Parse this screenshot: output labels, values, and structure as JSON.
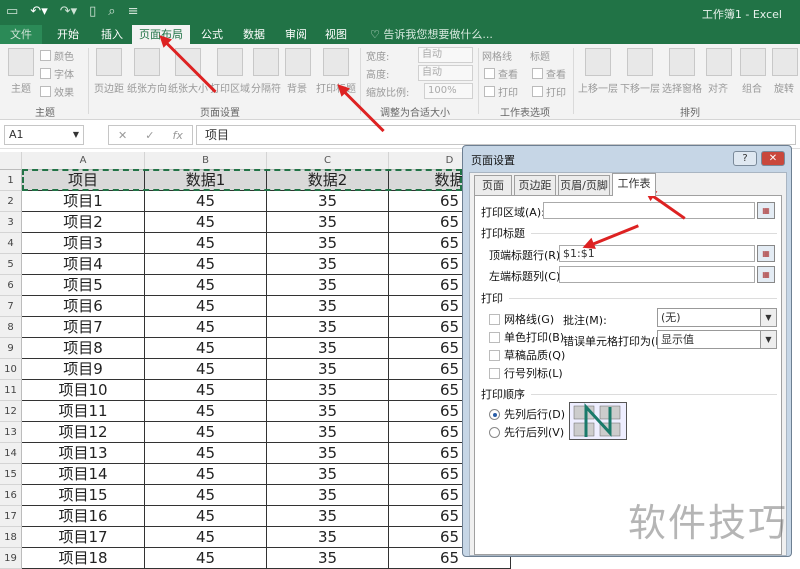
{
  "window": {
    "title": "工作簿1 - Excel"
  },
  "ribbon_tabs": [
    "文件",
    "开始",
    "插入",
    "页面布局",
    "公式",
    "数据",
    "审阅",
    "视图"
  ],
  "tell_me": "告诉我您想要做什么...",
  "ribbon": {
    "theme": {
      "big": "主题",
      "colors": "颜色",
      "fonts": "字体",
      "effects": "效果",
      "group": "主题"
    },
    "page_setup": {
      "items": [
        "页边距",
        "纸张方向",
        "纸张大小",
        "打印区域",
        "分隔符",
        "背景",
        "打印标题"
      ],
      "group": "页面设置"
    },
    "scale": {
      "width_label": "宽度:",
      "width": "自动",
      "height_label": "高度:",
      "height": "自动",
      "scale_label": "缩放比例:",
      "scale": "100%",
      "group": "调整为合适大小"
    },
    "sheet_options": {
      "gridlines": "网格线",
      "headings": "标题",
      "view": "查看",
      "print": "打印",
      "group": "工作表选项"
    },
    "arrange": {
      "items": [
        "上移一层",
        "下移一层",
        "选择窗格",
        "对齐",
        "组合",
        "旋转"
      ],
      "group": "排列"
    }
  },
  "formula_bar": {
    "name_box": "A1",
    "fx": "fx",
    "value": "项目"
  },
  "columns": [
    "A",
    "B",
    "C",
    "D"
  ],
  "header_row": [
    "项目",
    "数据1",
    "数据2",
    "数据"
  ],
  "rows": [
    [
      "项目1",
      "45",
      "35",
      "65"
    ],
    [
      "项目2",
      "45",
      "35",
      "65"
    ],
    [
      "项目3",
      "45",
      "35",
      "65"
    ],
    [
      "项目4",
      "45",
      "35",
      "65"
    ],
    [
      "项目5",
      "45",
      "35",
      "65"
    ],
    [
      "项目6",
      "45",
      "35",
      "65"
    ],
    [
      "项目7",
      "45",
      "35",
      "65"
    ],
    [
      "项目8",
      "45",
      "35",
      "65"
    ],
    [
      "项目9",
      "45",
      "35",
      "65"
    ],
    [
      "项目10",
      "45",
      "35",
      "65"
    ],
    [
      "项目11",
      "45",
      "35",
      "65"
    ],
    [
      "项目12",
      "45",
      "35",
      "65"
    ],
    [
      "项目13",
      "45",
      "35",
      "65"
    ],
    [
      "项目14",
      "45",
      "35",
      "65"
    ],
    [
      "项目15",
      "45",
      "35",
      "65"
    ],
    [
      "项目16",
      "45",
      "35",
      "65"
    ],
    [
      "项目17",
      "45",
      "35",
      "65"
    ],
    [
      "项目18",
      "45",
      "35",
      "65"
    ]
  ],
  "dialog": {
    "title": "页面设置",
    "help": "?",
    "close": "✕",
    "tabs": [
      "页面",
      "页边距",
      "页眉/页脚",
      "工作表"
    ],
    "print_area_label": "打印区域(A):",
    "print_area": "",
    "print_titles_section": "打印标题",
    "rows_to_repeat_label": "顶端标题行(R):",
    "rows_to_repeat": "$1:$1",
    "cols_to_repeat_label": "左端标题列(C):",
    "cols_to_repeat": "",
    "print_section": "打印",
    "checkboxes": [
      "网格线(G)",
      "单色打印(B)",
      "草稿品质(Q)",
      "行号列标(L)"
    ],
    "comments_label": "批注(M):",
    "comments": "(无)",
    "errors_label": "错误单元格打印为(E):",
    "errors": "显示值",
    "order_section": "打印顺序",
    "order_options": [
      "先列后行(D)",
      "先行后列(V)"
    ]
  },
  "watermark": "软件技巧",
  "colors": {
    "excel_green": "#217346",
    "annotation_red": "#dd2222"
  }
}
